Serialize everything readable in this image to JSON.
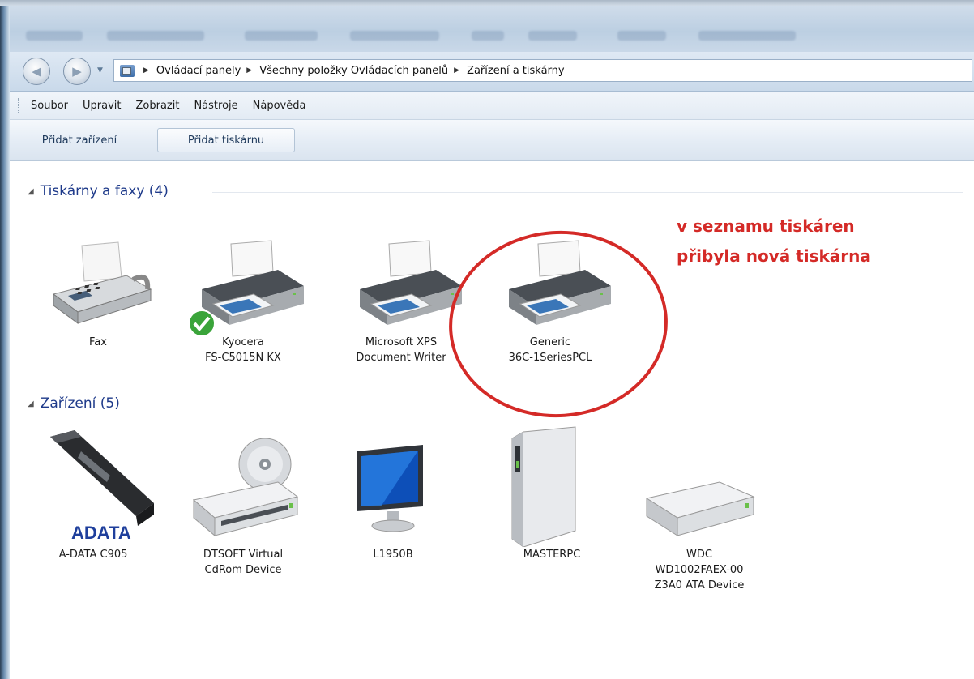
{
  "address": {
    "crumbs": [
      "Ovládací panely",
      "Všechny položky Ovládacích panelů",
      "Zařízení a tiskárny"
    ]
  },
  "menu": [
    "Soubor",
    "Upravit",
    "Zobrazit",
    "Nástroje",
    "Nápověda"
  ],
  "toolbar": {
    "add_device": "Přidat zařízení",
    "add_printer": "Přidat tiskárnu"
  },
  "groups": {
    "printers": {
      "title": "Tiskárny a faxy (4)",
      "items": [
        {
          "line1": "Fax",
          "line2": "",
          "icon": "fax-icon"
        },
        {
          "line1": "Kyocera",
          "line2": "FS-C5015N KX",
          "icon": "printer-icon",
          "default": true
        },
        {
          "line1": "Microsoft XPS",
          "line2": "Document Writer",
          "icon": "printer-icon"
        },
        {
          "line1": "Generic",
          "line2": "36C-1SeriesPCL",
          "icon": "printer-icon"
        }
      ]
    },
    "devices": {
      "title": "Zařízení (5)",
      "items": [
        {
          "line1": "A-DATA C905",
          "line2": "",
          "line3": "",
          "icon": "usb-flash-drive-icon",
          "logo": "ADATA"
        },
        {
          "line1": "DTSOFT Virtual",
          "line2": "CdRom Device",
          "line3": "",
          "icon": "cdrom-drive-icon"
        },
        {
          "line1": "L1950B",
          "line2": "",
          "line3": "",
          "icon": "monitor-icon"
        },
        {
          "line1": "MASTERPC",
          "line2": "",
          "line3": "",
          "icon": "computer-tower-icon"
        },
        {
          "line1": "WDC",
          "line2": "WD1002FAEX-00",
          "line3": "Z3A0 ATA Device",
          "icon": "hard-drive-icon"
        }
      ]
    }
  },
  "annotation": {
    "line1": "v seznamu tiskáren",
    "line2": "přibyla nová tiskárna",
    "color": "#d42a27"
  }
}
